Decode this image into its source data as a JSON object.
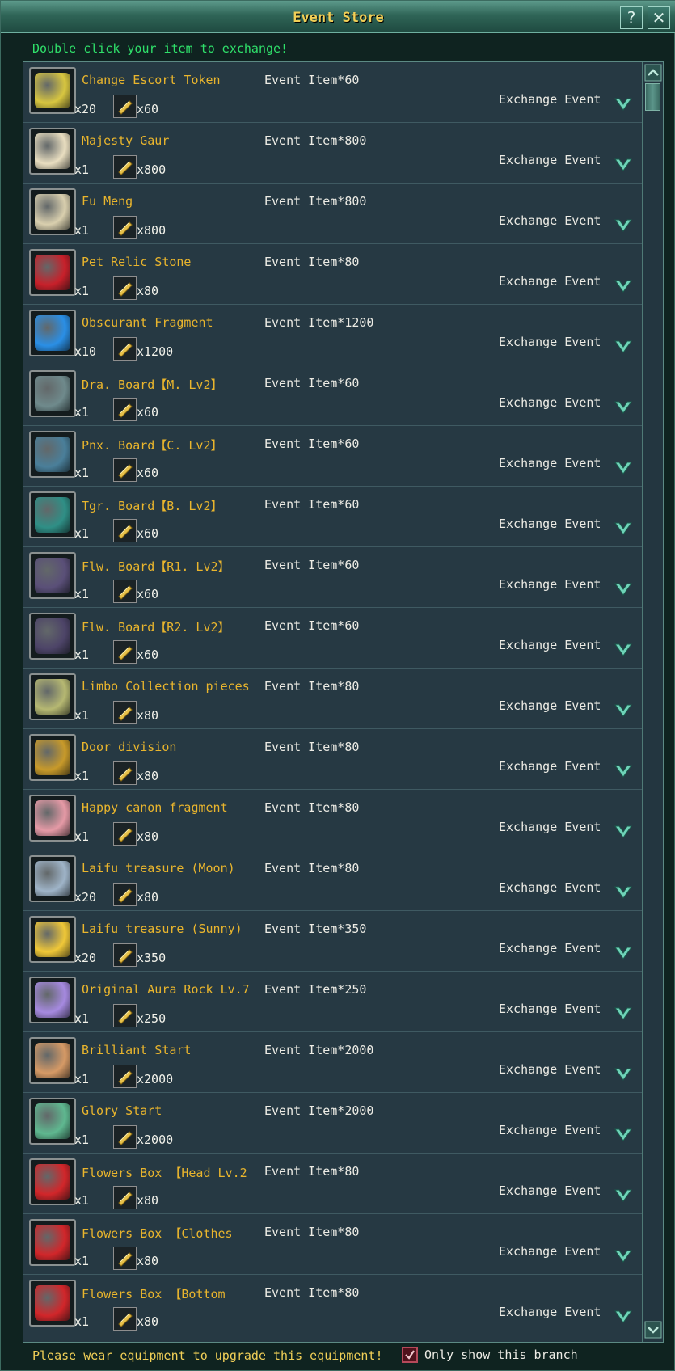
{
  "window": {
    "title": "Event Store",
    "help_label": "?",
    "close_label": "✕"
  },
  "hint": "Double click your item to exchange!",
  "items": [
    {
      "name": "Change Escort Token",
      "cost": "Event Item*60",
      "qty": "x20",
      "ticket": "x60",
      "action": "Exchange Event",
      "icon": "token-icon",
      "color": "#d8c640"
    },
    {
      "name": "Majesty Gaur",
      "cost": "Event Item*800",
      "qty": "x1",
      "ticket": "x800",
      "action": "Exchange Event",
      "icon": "mount-icon",
      "color": "#e9dec0"
    },
    {
      "name": "Fu Meng",
      "cost": "Event Item*800",
      "qty": "x1",
      "ticket": "x800",
      "action": "Exchange Event",
      "icon": "mount-icon",
      "color": "#d9cfae"
    },
    {
      "name": "Pet Relic Stone",
      "cost": "Event Item*80",
      "qty": "x1",
      "ticket": "x80",
      "action": "Exchange Event",
      "icon": "relic-stone-icon",
      "color": "#c8202a"
    },
    {
      "name": "Obscurant Fragment",
      "cost": "Event Item*1200",
      "qty": "x10",
      "ticket": "x1200",
      "action": "Exchange Event",
      "icon": "crystal-icon",
      "color": "#2a8fe6"
    },
    {
      "name": "Dra. Board【M. Lv2】",
      "cost": "Event Item*60",
      "qty": "x1",
      "ticket": "x60",
      "action": "Exchange Event",
      "icon": "board-icon",
      "color": "#6f8a8c"
    },
    {
      "name": "Pnx. Board【C. Lv2】",
      "cost": "Event Item*60",
      "qty": "x1",
      "ticket": "x60",
      "action": "Exchange Event",
      "icon": "board-icon",
      "color": "#4a7f9a"
    },
    {
      "name": "Tgr. Board【B. Lv2】",
      "cost": "Event Item*60",
      "qty": "x1",
      "ticket": "x60",
      "action": "Exchange Event",
      "icon": "board-icon",
      "color": "#2f8f86"
    },
    {
      "name": "Flw. Board【R1. Lv2】",
      "cost": "Event Item*60",
      "qty": "x1",
      "ticket": "x60",
      "action": "Exchange Event",
      "icon": "board-icon",
      "color": "#5a4f78"
    },
    {
      "name": "Flw. Board【R2. Lv2】",
      "cost": "Event Item*60",
      "qty": "x1",
      "ticket": "x60",
      "action": "Exchange Event",
      "icon": "board-icon",
      "color": "#4d4468"
    },
    {
      "name": "Limbo Collection pieces",
      "cost": "Event Item*80",
      "qty": "x1",
      "ticket": "x80",
      "action": "Exchange Event",
      "icon": "pieces-icon",
      "color": "#b6b872"
    },
    {
      "name": "Door         division",
      "cost": "Event Item*80",
      "qty": "x1",
      "ticket": "x80",
      "action": "Exchange Event",
      "icon": "book-icon",
      "color": "#c89a2a"
    },
    {
      "name": "Happy canon fragment",
      "cost": "Event Item*80",
      "qty": "x1",
      "ticket": "x80",
      "action": "Exchange Event",
      "icon": "fragment-icon",
      "color": "#e59aa6"
    },
    {
      "name": "Laifu treasure (Moon)",
      "cost": "Event Item*80",
      "qty": "x20",
      "ticket": "x80",
      "action": "Exchange Event",
      "icon": "scroll-icon",
      "color": "#9fb4c8"
    },
    {
      "name": "Laifu treasure (Sunny)",
      "cost": "Event Item*350",
      "qty": "x20",
      "ticket": "x350",
      "action": "Exchange Event",
      "icon": "scroll-icon",
      "color": "#f0c838"
    },
    {
      "name": "Original Aura Rock Lv.7",
      "cost": "Event Item*250",
      "qty": "x1",
      "ticket": "x250",
      "action": "Exchange Event",
      "icon": "orb-icon",
      "color": "#a68ae0"
    },
    {
      "name": "Brilliant Start",
      "cost": "Event Item*2000",
      "qty": "x1",
      "ticket": "x2000",
      "action": "Exchange Event",
      "icon": "ring-icon",
      "color": "#d69a66"
    },
    {
      "name": "Glory Start",
      "cost": "Event Item*2000",
      "qty": "x1",
      "ticket": "x2000",
      "action": "Exchange Event",
      "icon": "ring-icon",
      "color": "#5fb890"
    },
    {
      "name": "Flowers Box 【Head Lv.2",
      "cost": "Event Item*80",
      "qty": "x1",
      "ticket": "x80",
      "action": "Exchange Event",
      "icon": "gift-box-icon",
      "color": "#d2262a"
    },
    {
      "name": "Flowers Box  【Clothes",
      "cost": "Event Item*80",
      "qty": "x1",
      "ticket": "x80",
      "action": "Exchange Event",
      "icon": "gift-box-icon",
      "color": "#d2262a"
    },
    {
      "name": "Flowers Box  【Bottom",
      "cost": "Event Item*80",
      "qty": "x1",
      "ticket": "x80",
      "action": "Exchange Event",
      "icon": "gift-box-icon",
      "color": "#d2262a"
    }
  ],
  "footer": {
    "message": "Please wear equipment to upgrade this equipment!",
    "checkbox_label": "Only show this branch",
    "checkbox_checked": true
  },
  "colors": {
    "title": "#f1cf57",
    "hint": "#2fe06a",
    "item_name": "#e9b52d",
    "text": "#ecebe4",
    "panel_bg": "#263943"
  }
}
